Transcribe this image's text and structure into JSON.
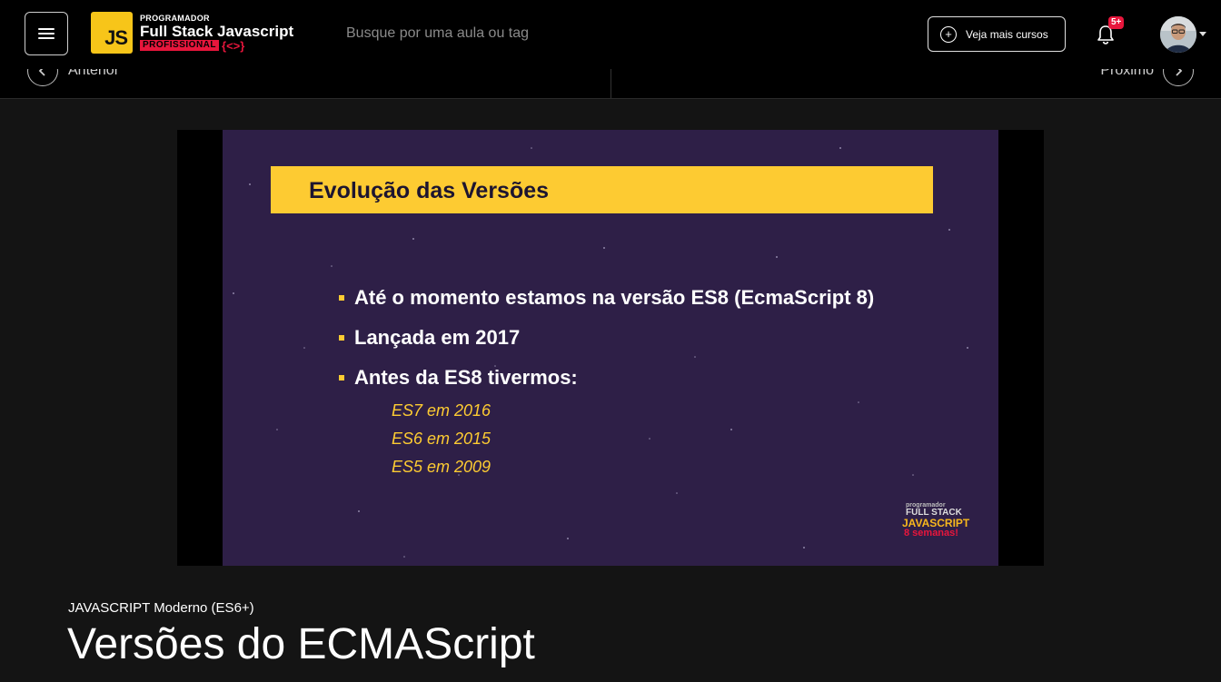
{
  "header": {
    "logo": {
      "badge": "JS",
      "line1": "PROGRAMADOR",
      "line2": "Full Stack Javascript",
      "line3": "PROFISSIONAL",
      "braces": "{<>}"
    },
    "search_placeholder": "Busque por uma aula ou tag",
    "more_courses_label": "Veja mais cursos",
    "notification_badge": "5+"
  },
  "lesson_nav": {
    "prev_label": "Anterior",
    "next_label": "Próximo"
  },
  "video": {
    "slide_title": "Evolução das Versões",
    "bullets": [
      "Até o momento estamos na versão ES8 (EcmaScript 8)",
      "Lançada em 2017",
      "Antes da ES8 tivermos:"
    ],
    "sub_items": [
      "ES7 em 2016",
      "ES6 em 2015",
      "ES5 em 2009"
    ],
    "watermark": {
      "line1": "programador",
      "line2": "FULL STACK",
      "line3": "JAVASCRIPT",
      "line4": "8 semanas!"
    }
  },
  "lesson": {
    "course_name": "JAVASCRIPT Moderno (ES6+)",
    "title": "Versões do ECMAScript"
  },
  "colors": {
    "accent_yellow": "#fdcb32",
    "accent_red": "#e8163c",
    "slide_background": "#2e1f47"
  }
}
